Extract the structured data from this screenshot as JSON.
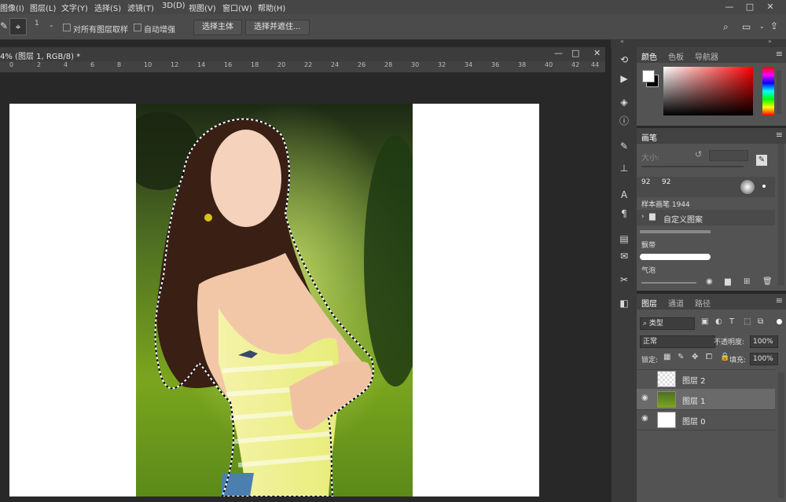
{
  "menubar": {
    "items": [
      "图像(I)",
      "图层(L)",
      "文字(Y)",
      "选择(S)",
      "滤镜(T)",
      "3D(D)",
      "视图(V)",
      "窗口(W)",
      "帮助(H)"
    ]
  },
  "window_controls": {
    "minimize": "—",
    "restore": "□",
    "close": "✕"
  },
  "options": {
    "brush_size": "1",
    "sample_all_layers_label": "对所有图层取样",
    "auto_enhance_label": "自动增强",
    "select_subject_label": "选择主体",
    "select_and_mask_label": "选择并遮住..."
  },
  "document": {
    "tab_title": "4% (图层 1, RGB/8) *",
    "ruler_ticks": [
      "0",
      "2",
      "4",
      "6",
      "8",
      "10",
      "12",
      "14",
      "16",
      "18",
      "20",
      "22",
      "24",
      "26",
      "28",
      "30",
      "32",
      "34",
      "36",
      "38",
      "40",
      "42",
      "44"
    ]
  },
  "color_panel": {
    "tabs": [
      "颜色",
      "色板",
      "导航器"
    ],
    "active_tab": "颜色",
    "foreground": "#ffffff",
    "background": "#000000",
    "picker_hue": "#ff0000"
  },
  "brush_panel": {
    "tab": "画笔",
    "size_label": "大小:",
    "presets": [
      "92",
      "92",
      "",
      "",
      "",
      "",
      ""
    ],
    "sample_brush_label": "样本画笔 1944",
    "group_label": "自定义图案",
    "brush_names": [
      "飘带",
      "气泡"
    ]
  },
  "layers_panel": {
    "tabs": [
      "图层",
      "通道",
      "路径"
    ],
    "active_tab": "图层",
    "filter_label": "类型",
    "blend_mode": "正常",
    "opacity_label": "不透明度:",
    "opacity_value": "100%",
    "lock_label": "锁定:",
    "fill_label": "填充:",
    "fill_value": "100%",
    "layers": [
      {
        "name": "图层 2",
        "visible": false,
        "selected": false
      },
      {
        "name": "图层 1",
        "visible": true,
        "selected": true
      },
      {
        "name": "图层 0",
        "visible": true,
        "selected": false
      }
    ]
  },
  "toolstrip_icons": [
    "history-icon",
    "play-icon",
    "3d-icon",
    "info-icon",
    "brush-icon",
    "stamp-icon",
    "type-icon",
    "paragraph-icon",
    "properties-icon",
    "notes-icon",
    "tools-icon",
    "adjust-icon"
  ],
  "colors": {
    "panel_bg": "#535353",
    "dark_bg": "#282828",
    "accent": "#1473e6"
  }
}
